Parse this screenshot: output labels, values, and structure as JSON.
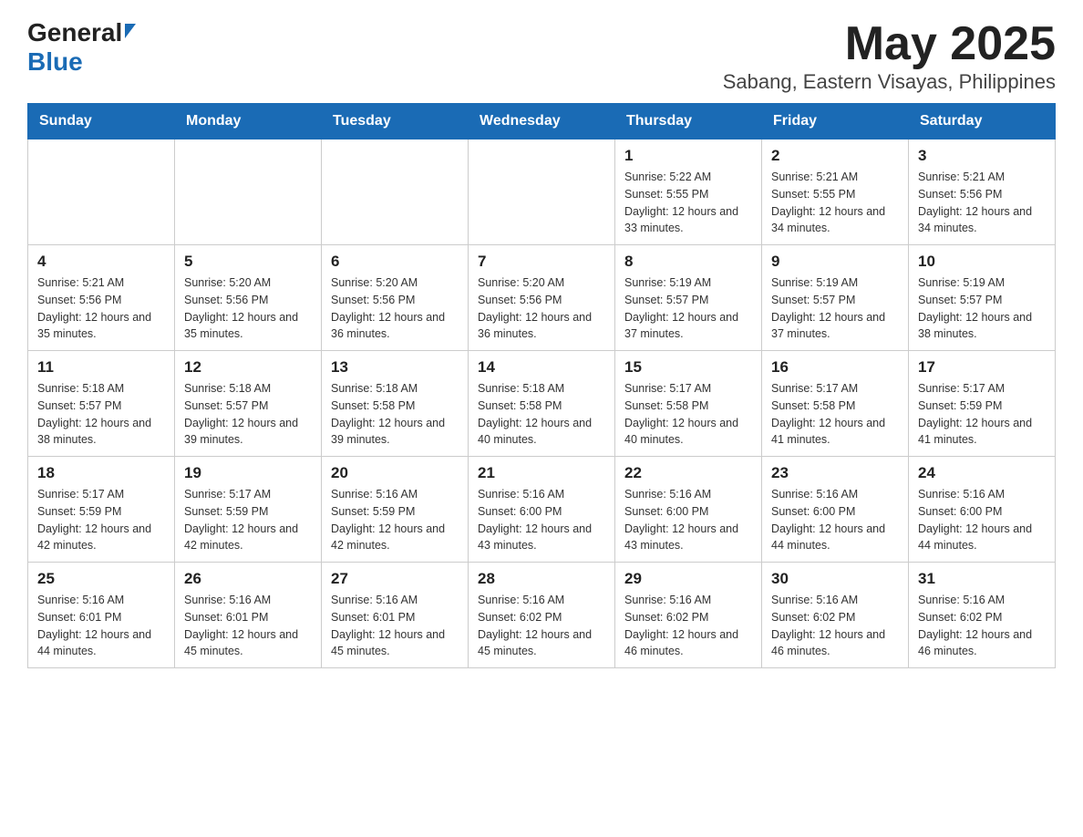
{
  "header": {
    "logo_general": "General",
    "logo_blue": "Blue",
    "title": "May 2025",
    "subtitle": "Sabang, Eastern Visayas, Philippines"
  },
  "days_of_week": [
    "Sunday",
    "Monday",
    "Tuesday",
    "Wednesday",
    "Thursday",
    "Friday",
    "Saturday"
  ],
  "weeks": [
    {
      "cells": [
        {
          "day": "",
          "sunrise": "",
          "sunset": "",
          "daylight": ""
        },
        {
          "day": "",
          "sunrise": "",
          "sunset": "",
          "daylight": ""
        },
        {
          "day": "",
          "sunrise": "",
          "sunset": "",
          "daylight": ""
        },
        {
          "day": "",
          "sunrise": "",
          "sunset": "",
          "daylight": ""
        },
        {
          "day": "1",
          "sunrise": "Sunrise: 5:22 AM",
          "sunset": "Sunset: 5:55 PM",
          "daylight": "Daylight: 12 hours and 33 minutes."
        },
        {
          "day": "2",
          "sunrise": "Sunrise: 5:21 AM",
          "sunset": "Sunset: 5:55 PM",
          "daylight": "Daylight: 12 hours and 34 minutes."
        },
        {
          "day": "3",
          "sunrise": "Sunrise: 5:21 AM",
          "sunset": "Sunset: 5:56 PM",
          "daylight": "Daylight: 12 hours and 34 minutes."
        }
      ]
    },
    {
      "cells": [
        {
          "day": "4",
          "sunrise": "Sunrise: 5:21 AM",
          "sunset": "Sunset: 5:56 PM",
          "daylight": "Daylight: 12 hours and 35 minutes."
        },
        {
          "day": "5",
          "sunrise": "Sunrise: 5:20 AM",
          "sunset": "Sunset: 5:56 PM",
          "daylight": "Daylight: 12 hours and 35 minutes."
        },
        {
          "day": "6",
          "sunrise": "Sunrise: 5:20 AM",
          "sunset": "Sunset: 5:56 PM",
          "daylight": "Daylight: 12 hours and 36 minutes."
        },
        {
          "day": "7",
          "sunrise": "Sunrise: 5:20 AM",
          "sunset": "Sunset: 5:56 PM",
          "daylight": "Daylight: 12 hours and 36 minutes."
        },
        {
          "day": "8",
          "sunrise": "Sunrise: 5:19 AM",
          "sunset": "Sunset: 5:57 PM",
          "daylight": "Daylight: 12 hours and 37 minutes."
        },
        {
          "day": "9",
          "sunrise": "Sunrise: 5:19 AM",
          "sunset": "Sunset: 5:57 PM",
          "daylight": "Daylight: 12 hours and 37 minutes."
        },
        {
          "day": "10",
          "sunrise": "Sunrise: 5:19 AM",
          "sunset": "Sunset: 5:57 PM",
          "daylight": "Daylight: 12 hours and 38 minutes."
        }
      ]
    },
    {
      "cells": [
        {
          "day": "11",
          "sunrise": "Sunrise: 5:18 AM",
          "sunset": "Sunset: 5:57 PM",
          "daylight": "Daylight: 12 hours and 38 minutes."
        },
        {
          "day": "12",
          "sunrise": "Sunrise: 5:18 AM",
          "sunset": "Sunset: 5:57 PM",
          "daylight": "Daylight: 12 hours and 39 minutes."
        },
        {
          "day": "13",
          "sunrise": "Sunrise: 5:18 AM",
          "sunset": "Sunset: 5:58 PM",
          "daylight": "Daylight: 12 hours and 39 minutes."
        },
        {
          "day": "14",
          "sunrise": "Sunrise: 5:18 AM",
          "sunset": "Sunset: 5:58 PM",
          "daylight": "Daylight: 12 hours and 40 minutes."
        },
        {
          "day": "15",
          "sunrise": "Sunrise: 5:17 AM",
          "sunset": "Sunset: 5:58 PM",
          "daylight": "Daylight: 12 hours and 40 minutes."
        },
        {
          "day": "16",
          "sunrise": "Sunrise: 5:17 AM",
          "sunset": "Sunset: 5:58 PM",
          "daylight": "Daylight: 12 hours and 41 minutes."
        },
        {
          "day": "17",
          "sunrise": "Sunrise: 5:17 AM",
          "sunset": "Sunset: 5:59 PM",
          "daylight": "Daylight: 12 hours and 41 minutes."
        }
      ]
    },
    {
      "cells": [
        {
          "day": "18",
          "sunrise": "Sunrise: 5:17 AM",
          "sunset": "Sunset: 5:59 PM",
          "daylight": "Daylight: 12 hours and 42 minutes."
        },
        {
          "day": "19",
          "sunrise": "Sunrise: 5:17 AM",
          "sunset": "Sunset: 5:59 PM",
          "daylight": "Daylight: 12 hours and 42 minutes."
        },
        {
          "day": "20",
          "sunrise": "Sunrise: 5:16 AM",
          "sunset": "Sunset: 5:59 PM",
          "daylight": "Daylight: 12 hours and 42 minutes."
        },
        {
          "day": "21",
          "sunrise": "Sunrise: 5:16 AM",
          "sunset": "Sunset: 6:00 PM",
          "daylight": "Daylight: 12 hours and 43 minutes."
        },
        {
          "day": "22",
          "sunrise": "Sunrise: 5:16 AM",
          "sunset": "Sunset: 6:00 PM",
          "daylight": "Daylight: 12 hours and 43 minutes."
        },
        {
          "day": "23",
          "sunrise": "Sunrise: 5:16 AM",
          "sunset": "Sunset: 6:00 PM",
          "daylight": "Daylight: 12 hours and 44 minutes."
        },
        {
          "day": "24",
          "sunrise": "Sunrise: 5:16 AM",
          "sunset": "Sunset: 6:00 PM",
          "daylight": "Daylight: 12 hours and 44 minutes."
        }
      ]
    },
    {
      "cells": [
        {
          "day": "25",
          "sunrise": "Sunrise: 5:16 AM",
          "sunset": "Sunset: 6:01 PM",
          "daylight": "Daylight: 12 hours and 44 minutes."
        },
        {
          "day": "26",
          "sunrise": "Sunrise: 5:16 AM",
          "sunset": "Sunset: 6:01 PM",
          "daylight": "Daylight: 12 hours and 45 minutes."
        },
        {
          "day": "27",
          "sunrise": "Sunrise: 5:16 AM",
          "sunset": "Sunset: 6:01 PM",
          "daylight": "Daylight: 12 hours and 45 minutes."
        },
        {
          "day": "28",
          "sunrise": "Sunrise: 5:16 AM",
          "sunset": "Sunset: 6:02 PM",
          "daylight": "Daylight: 12 hours and 45 minutes."
        },
        {
          "day": "29",
          "sunrise": "Sunrise: 5:16 AM",
          "sunset": "Sunset: 6:02 PM",
          "daylight": "Daylight: 12 hours and 46 minutes."
        },
        {
          "day": "30",
          "sunrise": "Sunrise: 5:16 AM",
          "sunset": "Sunset: 6:02 PM",
          "daylight": "Daylight: 12 hours and 46 minutes."
        },
        {
          "day": "31",
          "sunrise": "Sunrise: 5:16 AM",
          "sunset": "Sunset: 6:02 PM",
          "daylight": "Daylight: 12 hours and 46 minutes."
        }
      ]
    }
  ]
}
